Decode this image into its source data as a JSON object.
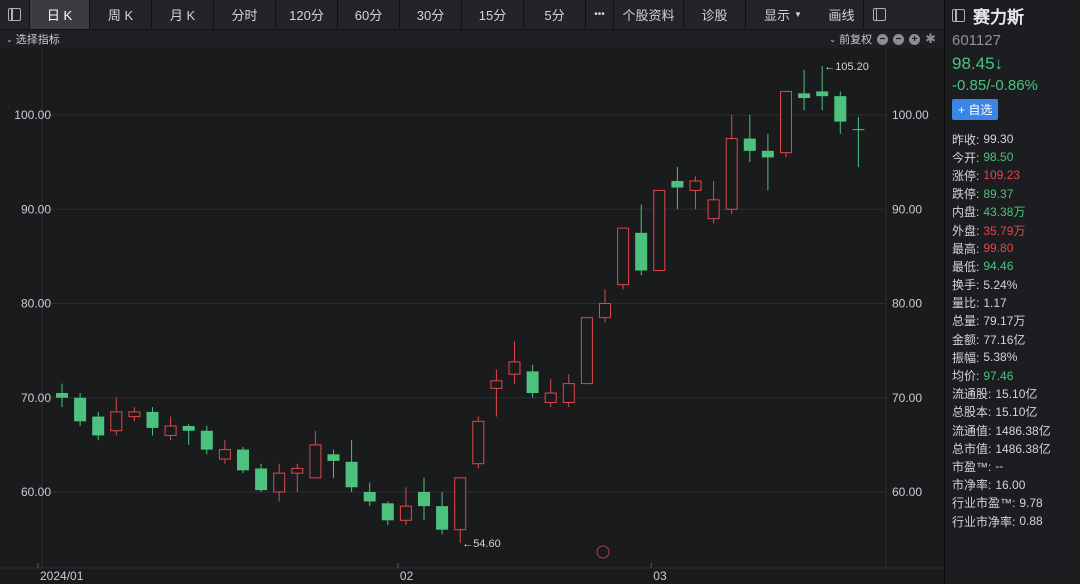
{
  "toolbar": {
    "tabs": [
      "日 K",
      "周 K",
      "月 K",
      "分时",
      "120分",
      "60分",
      "30分",
      "15分",
      "5分"
    ],
    "more": "•••",
    "profile": "个股资料",
    "diagnose": "诊股",
    "display": "显示",
    "draw": "画线"
  },
  "subbar": {
    "indicator": "选择指标",
    "adjust": "前复权"
  },
  "stock": {
    "name": "赛力斯",
    "code": "601127",
    "price": "98.45↓",
    "change": "-0.85/-0.86%",
    "add_watch": "+ 自选"
  },
  "stats": [
    {
      "label": "昨收:",
      "value": "99.30",
      "color": "white"
    },
    {
      "label": "今开:",
      "value": "98.50",
      "color": "green"
    },
    {
      "label": "涨停:",
      "value": "109.23",
      "color": "red"
    },
    {
      "label": "跌停:",
      "value": "89.37",
      "color": "green"
    },
    {
      "label": "内盘:",
      "value": "43.38万",
      "color": "green"
    },
    {
      "label": "外盘:",
      "value": "35.79万",
      "color": "red"
    },
    {
      "label": "最高:",
      "value": "99.80",
      "color": "red"
    },
    {
      "label": "最低:",
      "value": "94.46",
      "color": "green"
    },
    {
      "label": "换手:",
      "value": "5.24%",
      "color": "white"
    },
    {
      "label": "量比:",
      "value": "1.17",
      "color": "white"
    },
    {
      "label": "总量:",
      "value": "79.17万",
      "color": "white"
    },
    {
      "label": "金额:",
      "value": "77.16亿",
      "color": "white"
    },
    {
      "label": "振幅:",
      "value": "5.38%",
      "color": "white"
    },
    {
      "label": "均价:",
      "value": "97.46",
      "color": "green"
    },
    {
      "label": "流通股:",
      "value": "15.10亿",
      "color": "white"
    },
    {
      "label": "总股本:",
      "value": "15.10亿",
      "color": "white"
    },
    {
      "label": "流通值:",
      "value": "1486.38亿",
      "color": "white"
    },
    {
      "label": "总市值:",
      "value": "1486.38亿",
      "color": "white"
    },
    {
      "label": "市盈™:",
      "value": "--",
      "color": "white"
    },
    {
      "label": "市净率:",
      "value": "16.00",
      "color": "white"
    },
    {
      "label": "行业市盈™:",
      "value": "9.78",
      "color": "white"
    },
    {
      "label": "行业市净率:",
      "value": "0.88",
      "color": "white"
    }
  ],
  "colors": {
    "up": "#e0474a",
    "down": "#4cc27e",
    "grid": "#2c2d31",
    "axis_text": "#c9ccd1"
  },
  "chart_data": {
    "type": "candlestick",
    "y_ticks": [
      "60.00",
      "70.00",
      "80.00",
      "90.00",
      "100.00"
    ],
    "ylim": [
      54,
      106
    ],
    "x_labels": [
      {
        "index": 0,
        "label": "2024/01"
      },
      {
        "index": 19,
        "label": "02"
      },
      {
        "index": 33,
        "label": "03"
      }
    ],
    "max_marker": "←105.20",
    "min_marker": "←54.60",
    "candles": [
      {
        "o": 70.5,
        "c": 70.0,
        "h": 71.5,
        "l": 69.0
      },
      {
        "o": 70.0,
        "c": 67.5,
        "h": 70.5,
        "l": 67.0
      },
      {
        "o": 68.0,
        "c": 66.0,
        "h": 68.5,
        "l": 65.5
      },
      {
        "o": 66.5,
        "c": 68.5,
        "h": 70.0,
        "l": 66.0
      },
      {
        "o": 68.0,
        "c": 68.5,
        "h": 69.0,
        "l": 67.5
      },
      {
        "o": 68.5,
        "c": 66.8,
        "h": 69.0,
        "l": 66.0
      },
      {
        "o": 66.0,
        "c": 67.0,
        "h": 68.0,
        "l": 65.5
      },
      {
        "o": 67.0,
        "c": 66.5,
        "h": 67.2,
        "l": 65.0
      },
      {
        "o": 66.5,
        "c": 64.5,
        "h": 67.0,
        "l": 64.0
      },
      {
        "o": 63.5,
        "c": 64.5,
        "h": 65.5,
        "l": 63.0
      },
      {
        "o": 64.5,
        "c": 62.3,
        "h": 64.8,
        "l": 62.0
      },
      {
        "o": 62.5,
        "c": 60.2,
        "h": 63.0,
        "l": 60.0
      },
      {
        "o": 60.0,
        "c": 62.0,
        "h": 63.0,
        "l": 59.0
      },
      {
        "o": 62.0,
        "c": 62.5,
        "h": 63.0,
        "l": 60.0
      },
      {
        "o": 61.5,
        "c": 65.0,
        "h": 66.5,
        "l": 61.5
      },
      {
        "o": 64.0,
        "c": 63.3,
        "h": 64.5,
        "l": 61.5
      },
      {
        "o": 63.2,
        "c": 60.5,
        "h": 65.5,
        "l": 60.0
      },
      {
        "o": 60.0,
        "c": 59.0,
        "h": 61.0,
        "l": 58.5
      },
      {
        "o": 58.8,
        "c": 57.0,
        "h": 59.0,
        "l": 56.5
      },
      {
        "o": 57.0,
        "c": 58.5,
        "h": 60.5,
        "l": 56.5
      },
      {
        "o": 60.0,
        "c": 58.5,
        "h": 61.5,
        "l": 57.0
      },
      {
        "o": 58.5,
        "c": 56.0,
        "h": 60.0,
        "l": 55.5
      },
      {
        "o": 56.0,
        "c": 61.5,
        "h": 61.5,
        "l": 54.6
      },
      {
        "o": 63.0,
        "c": 67.5,
        "h": 68.0,
        "l": 62.5
      },
      {
        "o": 71.0,
        "c": 71.8,
        "h": 73.0,
        "l": 68.0
      },
      {
        "o": 72.5,
        "c": 73.8,
        "h": 76.0,
        "l": 71.5
      },
      {
        "o": 72.8,
        "c": 70.5,
        "h": 73.5,
        "l": 70.0
      },
      {
        "o": 69.5,
        "c": 70.5,
        "h": 72.0,
        "l": 69.0
      },
      {
        "o": 69.5,
        "c": 71.5,
        "h": 72.5,
        "l": 69.0
      },
      {
        "o": 71.5,
        "c": 78.5,
        "h": 78.5,
        "l": 71.5
      },
      {
        "o": 78.5,
        "c": 80.0,
        "h": 81.5,
        "l": 78.0
      },
      {
        "o": 82.0,
        "c": 88.0,
        "h": 88.0,
        "l": 81.5
      },
      {
        "o": 87.5,
        "c": 83.5,
        "h": 90.5,
        "l": 83.0
      },
      {
        "o": 83.5,
        "c": 92.0,
        "h": 92.0,
        "l": 83.5
      },
      {
        "o": 93.0,
        "c": 92.3,
        "h": 94.5,
        "l": 90.0
      },
      {
        "o": 92.0,
        "c": 93.0,
        "h": 93.5,
        "l": 90.0
      },
      {
        "o": 89.0,
        "c": 91.0,
        "h": 93.0,
        "l": 88.5
      },
      {
        "o": 90.0,
        "c": 97.5,
        "h": 100.0,
        "l": 89.5
      },
      {
        "o": 97.5,
        "c": 96.2,
        "h": 100.0,
        "l": 95.0
      },
      {
        "o": 96.2,
        "c": 95.5,
        "h": 98.0,
        "l": 92.0
      },
      {
        "o": 96.0,
        "c": 102.5,
        "h": 102.5,
        "l": 95.5
      },
      {
        "o": 102.3,
        "c": 101.8,
        "h": 104.8,
        "l": 100.5
      },
      {
        "o": 102.5,
        "c": 102.0,
        "h": 105.2,
        "l": 100.5
      },
      {
        "o": 102.0,
        "c": 99.3,
        "h": 102.5,
        "l": 98.0
      },
      {
        "o": 98.5,
        "c": 98.45,
        "h": 99.8,
        "l": 94.46
      }
    ]
  }
}
